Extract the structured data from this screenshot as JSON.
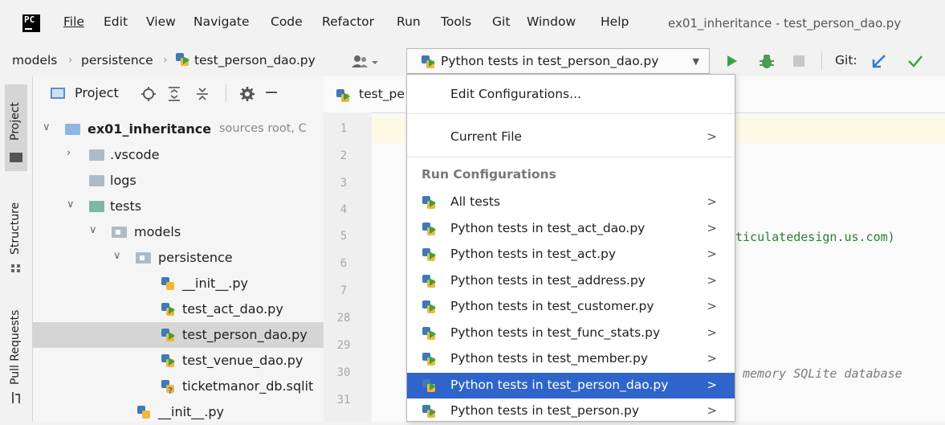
{
  "menu": {
    "items": [
      "File",
      "Edit",
      "View",
      "Navigate",
      "Code",
      "Refactor",
      "Run",
      "Tools",
      "Git",
      "Window",
      "Help"
    ],
    "logo": "PC",
    "window_title": "ex01_inheritance - test_person_dao.py"
  },
  "navbar": {
    "crumbs": [
      "models",
      "persistence",
      "test_person_dao.py"
    ],
    "run_config": "Python tests in test_person_dao.py",
    "git_label": "Git:"
  },
  "stripe": {
    "project": "Project",
    "structure": "Structure",
    "pull_requests": "Pull Requests"
  },
  "project_panel": {
    "title": "Project",
    "tree": [
      {
        "label": "ex01_inheritance",
        "suffix": "sources root, C"
      },
      {
        "label": ".vscode"
      },
      {
        "label": "logs"
      },
      {
        "label": "tests"
      },
      {
        "label": "models"
      },
      {
        "label": "persistence"
      },
      {
        "label": "__init__.py"
      },
      {
        "label": "test_act_dao.py"
      },
      {
        "label": "test_person_dao.py"
      },
      {
        "label": "test_venue_dao.py"
      },
      {
        "label": "ticketmanor_db.sqlit"
      },
      {
        "label": "__init__.py"
      }
    ]
  },
  "editor": {
    "tab": "test_pe",
    "line_numbers": [
      "1",
      "2",
      "3",
      "4",
      "5",
      "6",
      "7",
      "28",
      "29",
      "30",
      "31"
    ],
    "code_fragments": [
      "ticulatedesign.us.com)",
      "memory SQLite database"
    ]
  },
  "popup": {
    "edit_configurations": "Edit Configurations...",
    "current_file": "Current File",
    "run_configurations_header": "Run Configurations",
    "arrow": ">",
    "items": [
      "All tests",
      "Python tests in test_act_dao.py",
      "Python tests in test_act.py",
      "Python tests in test_address.py",
      "Python tests in test_customer.py",
      "Python tests in test_func_stats.py",
      "Python tests in test_member.py",
      "Python tests in test_person_dao.py",
      "Python tests in test_person.py"
    ],
    "selected_index": 7
  },
  "colors": {
    "selection": "#2f65ca",
    "run_green": "#3aa14a",
    "string_green": "#2e7d32"
  }
}
